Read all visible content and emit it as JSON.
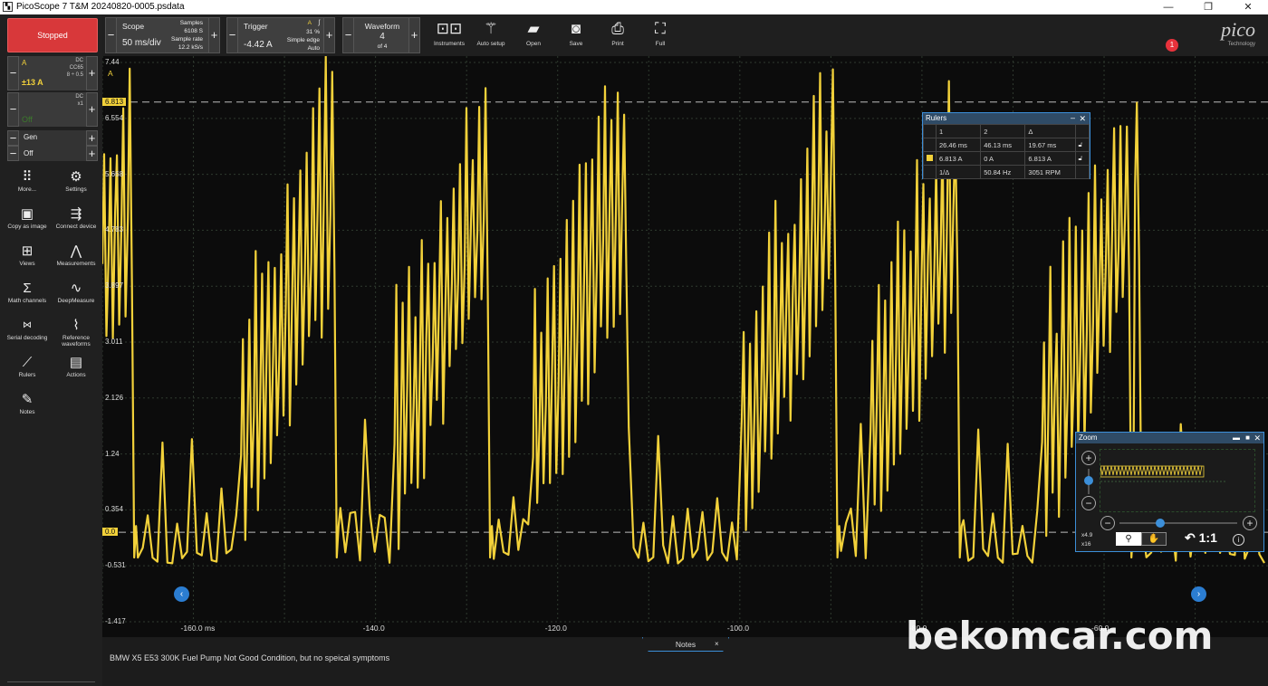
{
  "window": {
    "title": "PicoScope 7 T&M 20240820-0005.psdata",
    "app_icon": "picoscope-icon"
  },
  "sidebar": {
    "stop_label": "Stopped",
    "channel_a": {
      "name": "A",
      "range": "±13 A",
      "coupling": "DC",
      "probe": "CC65",
      "probe_detail": "8 ÷ 0.5"
    },
    "channel_b": {
      "coupling": "DC",
      "multiplier": "x1",
      "state": "Off"
    },
    "gen": {
      "label": "Gen",
      "state": "Off"
    },
    "items": [
      {
        "label": "More...",
        "icon": "grid-dots-icon"
      },
      {
        "label": "Settings",
        "icon": "gear-icon"
      },
      {
        "label": "Copy as image",
        "icon": "image-icon"
      },
      {
        "label": "Connect device",
        "icon": "usb-icon"
      },
      {
        "label": "Views",
        "icon": "views-grid-icon"
      },
      {
        "label": "Measurements",
        "icon": "compass-icon"
      },
      {
        "label": "Math channels",
        "icon": "sigma-icon"
      },
      {
        "label": "DeepMeasure",
        "icon": "wave-measure-icon"
      },
      {
        "label": "Serial decoding",
        "icon": "binary-icon"
      },
      {
        "label": "Reference waveforms",
        "icon": "reference-wave-icon"
      },
      {
        "label": "Rulers",
        "icon": "ruler-icon"
      },
      {
        "label": "Actions",
        "icon": "clapper-icon"
      },
      {
        "label": "Notes",
        "icon": "notes-icon"
      }
    ]
  },
  "toolbar": {
    "scope": {
      "label": "Scope",
      "timebase": "50 ms/div",
      "samples_label": "Samples",
      "samples": "6108 S",
      "rate_label": "Sample rate",
      "rate": "12.2 kS/s"
    },
    "trigger": {
      "label": "Trigger",
      "level": "-4.42 A",
      "channel": "A",
      "percent": "31 %",
      "type": "Simple edge",
      "mode": "Auto"
    },
    "waveform": {
      "label": "Waveform",
      "index": "4",
      "of": "of 4"
    },
    "buttons": [
      {
        "label": "Instruments",
        "icon": "instruments-icon"
      },
      {
        "label": "Auto setup",
        "icon": "magic-wand-icon"
      },
      {
        "label": "Open",
        "icon": "folder-icon"
      },
      {
        "label": "Save",
        "icon": "save-icon"
      },
      {
        "label": "Print",
        "icon": "print-icon"
      },
      {
        "label": "Full",
        "icon": "fullscreen-icon"
      }
    ],
    "logo": {
      "text": "pico",
      "sub": "Technology"
    },
    "notification_count": "1"
  },
  "plot": {
    "unit": "A",
    "y_ticks": [
      "7.44",
      "6.554",
      "5.668",
      "4.783",
      "3.897",
      "3.011",
      "2.126",
      "1.24",
      "0.354",
      "-0.531",
      "-1.417"
    ],
    "ruler_labels": [
      "6.813",
      "0.0"
    ],
    "x_ticks": [
      "-160.0 ms",
      "-140.0",
      "-120.0",
      "-100.0",
      "-80.0",
      "-60.0"
    ]
  },
  "chart_data": {
    "type": "line",
    "xlabel": "",
    "ylabel": "A",
    "x_range": [
      -170,
      -42
    ],
    "ylim": [
      -1.417,
      7.44
    ],
    "grid": true,
    "series_color": "#f2d13a",
    "cycle_period_ms": 19.67,
    "cycle_start_ms": [
      -168.5,
      -148.8,
      -129.2,
      -109.5,
      -89.8,
      -70.1,
      -50.4
    ],
    "ruler_y": [
      6.813,
      0.0
    ],
    "burst_peak_times_ms": [
      -168,
      -146,
      -129,
      -114,
      -91,
      -77,
      -58
    ],
    "typical_peak_A": 1.4,
    "typical_trough_A": -0.5
  },
  "rulers_panel": {
    "title": "Rulers",
    "header": [
      "1",
      "2",
      "Δ"
    ],
    "time_row": [
      "26.46 ms",
      "46.13 ms",
      "19.67 ms"
    ],
    "amp_row": [
      "6.813 A",
      "0 A",
      "6.813 A"
    ],
    "freq_row": [
      "1/Δ",
      "50.84 Hz",
      "3051 RPM"
    ],
    "amp_color": "#f2d13a"
  },
  "zoom_panel": {
    "title": "Zoom",
    "zoom_x": "x4.9",
    "zoom_y": "x16",
    "reset": "1:1"
  },
  "notes": {
    "tab_label": "Notes",
    "text": "BMW X5 E53 300K Fuel Pump Not Good Condition, but no speical symptoms"
  },
  "watermark": "bekomcar.com"
}
